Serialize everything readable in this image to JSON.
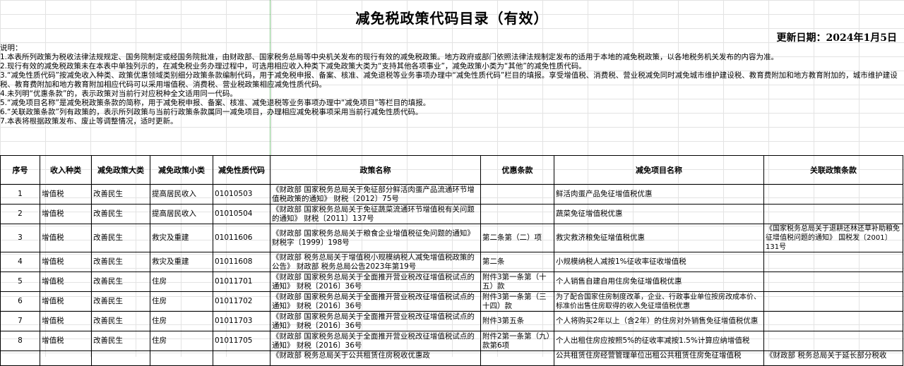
{
  "title": "减免税政策代码目录（有效）",
  "update_date": "更新日期：2024年1月5日",
  "notes": [
    "说明：",
    "1.本表所列政策为税收法律法规规定、国务院制定或经国务院批准，由财政部、国家税务总局等中央机关发布的现行有效的减免税政策。地方政府或部门依照法律法规制定发布的适用于本地的减免税政策，以各地税务机关发布的内容为准。",
    "2.现行有效的减免税政策未在本表中单独列示的，在减免税业务办理过程中，可选用相应收入种类下减免政策大类为“支持其他各项事业”，减免政策小类为“其他”的减免性质代码。",
    "3.“减免性质代码”按减免收入种类、政策优惠领域类别细分政策条款编制代码，用于减免税申报、备案、核准、减免退税等业务事项办理中“减免性质代码”栏目的填报。享受增值税、消费税、营业税减免同时减免城市维护建设税、教育费附加和地方教育附加的，城市维护建设税、教育费附加和地方教育附加相应代码可以采用增值税、消费税、营业税政策相应减免性质代码。",
    "4.未列明“优惠条款”的，表示政策对当前行对应税种全文适用同一代码。",
    "5.“减免项目名称”是减免税政策条款的简称，用于减免税申报、备案、核准、减免退税等业务事项办理中“减免项目”等栏目的填报。",
    "6.“关联政策条款”列有政策的，表示所列政策与当前行政策条款属同一减免项目，办理相应减免税事项采用当前行减免性质代码。",
    "7.本表将根据政策发布、废止等调整情况，适时更新。"
  ],
  "table": {
    "headers": [
      "序号",
      "收入种类",
      "减免政策大类",
      "减免政策小类",
      "减免性质代码",
      "政策名称",
      "优惠条款",
      "减免项目名称",
      "关联政策条款"
    ],
    "rows": [
      [
        "1",
        "增值税",
        "改善民生",
        "提高居民收入",
        "01010503",
        "《财政部 国家税务总局关于免征部分鲜活肉蛋产品流通环节增值税政策的通知》 财税〔2012〕75号",
        "",
        "鲜活肉蛋产品免征增值税优惠",
        ""
      ],
      [
        "2",
        "增值税",
        "改善民生",
        "提高居民收入",
        "01010504",
        "《财政部 国家税务总局关于免征蔬菜流通环节增值税有关问题的通知》 财税〔2011〕137号",
        "",
        "蔬菜免征增值税优惠",
        ""
      ],
      [
        "3",
        "增值税",
        "改善民生",
        "救灾及重建",
        "01011606",
        "《财政部 国家税务总局关于粮食企业增值税征免问题的通知》 财税字〔1999〕198号",
        "第二条第（二）项",
        "救灾救济粮免征增值税优惠",
        "《国家税务总局关于退耕还林还草补助粮免征增值税问题的通知》 国税发〔2001〕131号"
      ],
      [
        "4",
        "增值税",
        "改善民生",
        "救灾及重建",
        "01011608",
        "《财政部 税务总局关于增值税小规模纳税人减免增值税政策的公告》 财政部 税务总局公告2023年第19号",
        "第二条",
        "小规模纳税人减按1%征收率征收增值税",
        ""
      ],
      [
        "5",
        "增值税",
        "改善民生",
        "住房",
        "01011701",
        "《财政部 国家税务总局关于全面推开营业税改征增值税试点的通知》 财税〔2016〕36号",
        "附件3第一条第（十五）款",
        "个人销售自建自用住房免征增值税优惠",
        ""
      ],
      [
        "6",
        "增值税",
        "改善民生",
        "住房",
        "01011702",
        "《财政部 国家税务总局关于全面推开营业税改征增值税试点的通知》 财税〔2016〕36号",
        "附件3第一条第（三十四）款",
        "为了配合国家住房制度改革，企业、行政事业单位按房改成本价、标准价出售住房取得的收入免征增值税优惠",
        ""
      ],
      [
        "7",
        "增值税",
        "改善民生",
        "住房",
        "01011703",
        "《财政部 国家税务总局关于全面推开营业税改征增值税试点的通知》 财税〔2016〕36号",
        "附件3第五条",
        "个人将购买2年以上（含2年）的住房对外销售免征增值税优惠",
        ""
      ],
      [
        "8",
        "增值税",
        "改善民生",
        "住房",
        "01011705",
        "《财政部 国家税务总局关于全面推开营业税改征增值税试点的通知》 财税〔2016〕36号",
        "附件2第一条第（九）款第6项",
        "个人出租住房应按照5%的征收率减按1.5%计算应纳增值税",
        ""
      ],
      [
        "",
        "",
        "",
        "",
        "",
        "《财政部 税务总局关于公共租赁住房税收优惠政",
        "",
        "公共租赁住房经营管理单位出租公共租赁住房免征增值税",
        "《财政部 税务总局关于延长部分税收"
      ]
    ]
  }
}
